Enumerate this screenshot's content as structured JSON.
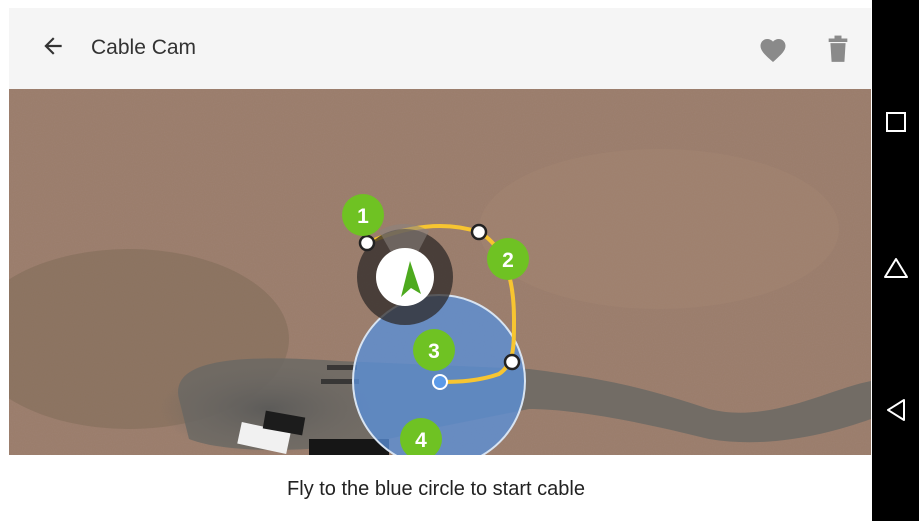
{
  "app_bar": {
    "title": "Cable Cam",
    "back_icon": "arrow-left-icon",
    "favorite_icon": "heart-icon",
    "delete_icon": "trash-icon",
    "background": "#f5f5f5",
    "icon_color": "#8a8a8a"
  },
  "map": {
    "path_color": "#f7c531",
    "waypoint_color": "#6fc223",
    "target_circle_color": "#5a8fd8",
    "waypoints": [
      {
        "label": "1"
      },
      {
        "label": "2"
      },
      {
        "label": "3"
      },
      {
        "label": "4"
      }
    ],
    "drone_icon": "drone-arrow-icon"
  },
  "instruction": "Fly to the blue circle to start cable",
  "system_nav": {
    "recents_icon": "square-icon",
    "home_icon": "home-icon",
    "back_icon": "triangle-back-icon"
  }
}
